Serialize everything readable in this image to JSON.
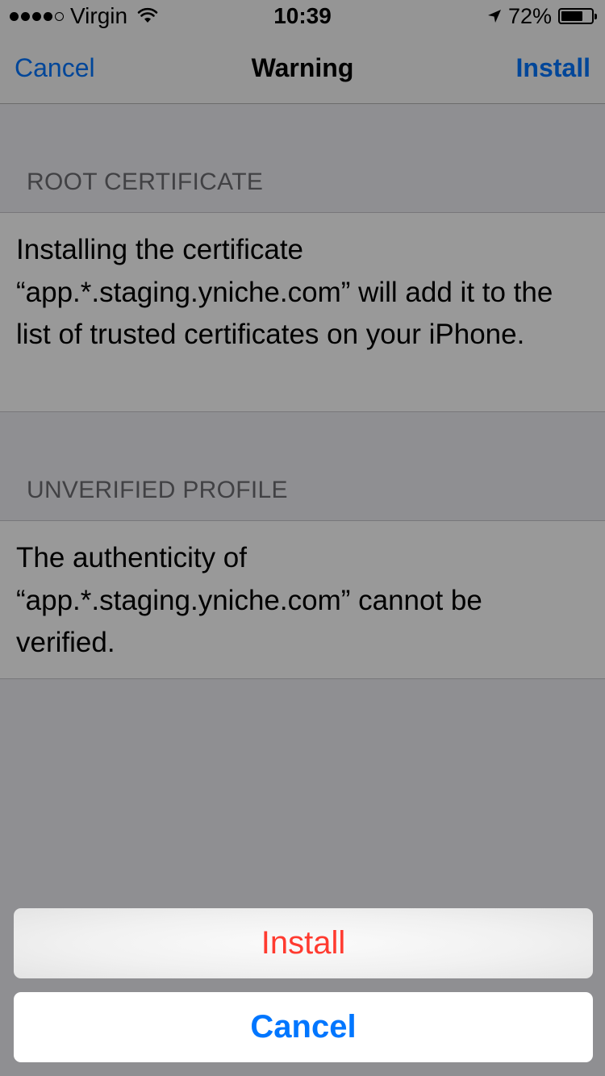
{
  "status_bar": {
    "carrier": "Virgin",
    "time": "10:39",
    "battery_pct": "72%",
    "battery_level": 0.72,
    "signal_strength": 4,
    "signal_max": 5,
    "icons": [
      "signal-dots-icon",
      "wifi-icon",
      "location-arrow-icon",
      "battery-icon"
    ]
  },
  "nav": {
    "left": "Cancel",
    "title": "Warning",
    "right": "Install"
  },
  "sections": [
    {
      "header": "ROOT CERTIFICATE",
      "text": "Installing the certificate “app.*.staging.yniche.com” will add it to the list of trusted certificates on your iPhone."
    },
    {
      "header": "UNVERIFIED PROFILE",
      "text": "The authenticity of “app.*.staging.yniche.com” cannot be verified."
    }
  ],
  "action_sheet": {
    "install": "Install",
    "cancel": "Cancel"
  },
  "colors": {
    "tint": "#0076ff",
    "destructive": "#ff3b30",
    "background": "#efeff4"
  }
}
